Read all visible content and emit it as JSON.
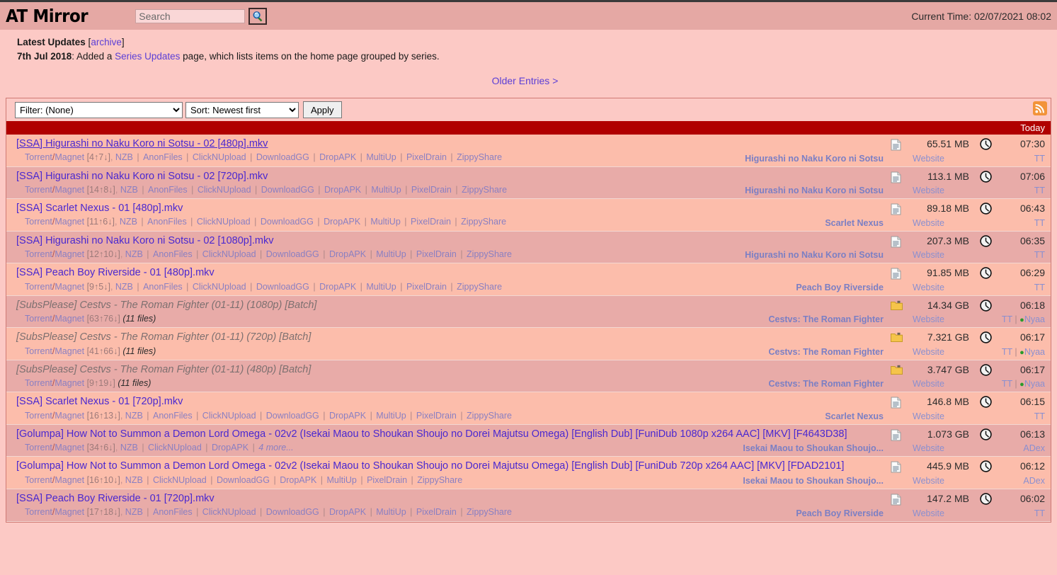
{
  "header": {
    "logo": "AT Mirror",
    "search_placeholder": "Search",
    "search_value": "",
    "search_icon": "magnifier-icon",
    "current_time": "Current Time: 02/07/2021 08:02"
  },
  "updates": {
    "heading": "Latest Updates",
    "archive_bracket_open": "[",
    "archive_label": "archive",
    "archive_bracket_close": "]",
    "date": "7th Jul 2018",
    "text_before": ": Added a ",
    "link_label": "Series Updates",
    "text_after": " page, which lists items on the home page grouped by series."
  },
  "pagination": {
    "older_label": "Older Entries >"
  },
  "toolbar": {
    "filter_selected": "Filter: (None)",
    "sort_selected": "Sort: Newest first",
    "apply_label": "Apply",
    "rss_icon": "rss-icon"
  },
  "day_header": "Today",
  "labels": {
    "torrent": "Torrent",
    "magnet": "Magnet",
    "nzb": "NZB",
    "website": "Website",
    "tt": "TT",
    "nyaa": "Nyaa",
    "adex": "ADex",
    "more": "4 more..."
  },
  "rows": [
    {
      "title": "[SSA] Higurashi no Naku Koro ni Sotsu - 02 [480p].mkv",
      "batch": false,
      "hovered": true,
      "wide": false,
      "peers": "[4↑7↓]",
      "mirrors": [
        "AnonFiles",
        "ClickNUpload",
        "DownloadGG",
        "DropAPK",
        "MultiUp",
        "PixelDrain",
        "ZippyShare"
      ],
      "has_nzb": true,
      "filecount": "",
      "series": "Higurashi no Naku Koro ni Sotsu",
      "size": "65.51 MB",
      "size_icon": "file-icon",
      "time": "07:30",
      "tags": [
        "TT"
      ]
    },
    {
      "title": "[SSA] Higurashi no Naku Koro ni Sotsu - 02 [720p].mkv",
      "batch": false,
      "hovered": false,
      "wide": false,
      "peers": "[14↑8↓]",
      "mirrors": [
        "AnonFiles",
        "ClickNUpload",
        "DownloadGG",
        "DropAPK",
        "MultiUp",
        "PixelDrain",
        "ZippyShare"
      ],
      "has_nzb": true,
      "filecount": "",
      "series": "Higurashi no Naku Koro ni Sotsu",
      "size": "113.1 MB",
      "size_icon": "file-icon",
      "time": "07:06",
      "tags": [
        "TT"
      ]
    },
    {
      "title": "[SSA] Scarlet Nexus - 01 [480p].mkv",
      "batch": false,
      "hovered": false,
      "wide": false,
      "peers": "[11↑6↓]",
      "mirrors": [
        "AnonFiles",
        "ClickNUpload",
        "DownloadGG",
        "DropAPK",
        "MultiUp",
        "PixelDrain",
        "ZippyShare"
      ],
      "has_nzb": true,
      "filecount": "",
      "series": "Scarlet Nexus",
      "size": "89.18 MB",
      "size_icon": "file-icon",
      "time": "06:43",
      "tags": [
        "TT"
      ]
    },
    {
      "title": "[SSA] Higurashi no Naku Koro ni Sotsu - 02 [1080p].mkv",
      "batch": false,
      "hovered": false,
      "wide": false,
      "peers": "[12↑10↓]",
      "mirrors": [
        "AnonFiles",
        "ClickNUpload",
        "DownloadGG",
        "DropAPK",
        "MultiUp",
        "PixelDrain",
        "ZippyShare"
      ],
      "has_nzb": true,
      "filecount": "",
      "series": "Higurashi no Naku Koro ni Sotsu",
      "size": "207.3 MB",
      "size_icon": "file-icon",
      "time": "06:35",
      "tags": [
        "TT"
      ]
    },
    {
      "title": "[SSA] Peach Boy Riverside - 01 [480p].mkv",
      "batch": false,
      "hovered": false,
      "wide": false,
      "peers": "[9↑5↓]",
      "mirrors": [
        "AnonFiles",
        "ClickNUpload",
        "DownloadGG",
        "DropAPK",
        "MultiUp",
        "PixelDrain",
        "ZippyShare"
      ],
      "has_nzb": true,
      "filecount": "",
      "series": "Peach Boy Riverside",
      "size": "91.85 MB",
      "size_icon": "file-icon",
      "time": "06:29",
      "tags": [
        "TT"
      ]
    },
    {
      "title": "[SubsPlease] Cestvs - The Roman Fighter (01-11) (1080p) [Batch]",
      "batch": true,
      "hovered": false,
      "wide": false,
      "peers": "[63↑76↓]",
      "mirrors": [],
      "has_nzb": false,
      "filecount": "(11 files)",
      "series": "Cestvs: The Roman Fighter",
      "size": "14.34 GB",
      "size_icon": "folder-icon",
      "time": "06:18",
      "tags": [
        "TT",
        "Nyaa"
      ]
    },
    {
      "title": "[SubsPlease] Cestvs - The Roman Fighter (01-11) (720p) [Batch]",
      "batch": true,
      "hovered": false,
      "wide": false,
      "peers": "[41↑66↓]",
      "mirrors": [],
      "has_nzb": false,
      "filecount": "(11 files)",
      "series": "Cestvs: The Roman Fighter",
      "size": "7.321 GB",
      "size_icon": "folder-icon",
      "time": "06:17",
      "tags": [
        "TT",
        "Nyaa"
      ]
    },
    {
      "title": "[SubsPlease] Cestvs - The Roman Fighter (01-11) (480p) [Batch]",
      "batch": true,
      "hovered": false,
      "wide": false,
      "peers": "[9↑19↓]",
      "mirrors": [],
      "has_nzb": false,
      "filecount": "(11 files)",
      "series": "Cestvs: The Roman Fighter",
      "size": "3.747 GB",
      "size_icon": "folder-icon",
      "time": "06:17",
      "tags": [
        "TT",
        "Nyaa"
      ]
    },
    {
      "title": "[SSA] Scarlet Nexus - 01 [720p].mkv",
      "batch": false,
      "hovered": false,
      "wide": false,
      "peers": "[16↑13↓]",
      "mirrors": [
        "AnonFiles",
        "ClickNUpload",
        "DownloadGG",
        "DropAPK",
        "MultiUp",
        "PixelDrain",
        "ZippyShare"
      ],
      "has_nzb": true,
      "filecount": "",
      "series": "Scarlet Nexus",
      "size": "146.8 MB",
      "size_icon": "file-icon",
      "time": "06:15",
      "tags": [
        "TT"
      ]
    },
    {
      "title": "[Golumpa] How Not to Summon a Demon Lord Omega - 02v2 (Isekai Maou to Shoukan Shoujo no Dorei Majutsu Omega) [English Dub] [FuniDub 1080p x264 AAC] [MKV] [F4643D38]",
      "batch": false,
      "hovered": false,
      "wide": true,
      "peers": "[34↑6↓]",
      "mirrors": [
        "ClickNUpload",
        "DropAPK"
      ],
      "has_nzb": true,
      "filecount": "",
      "more_label": "4 more...",
      "series": "Isekai Maou to Shoukan Shoujo...",
      "size": "1.073 GB",
      "size_icon": "file-icon",
      "time": "06:13",
      "tags": [
        "ADex"
      ]
    },
    {
      "title": "[Golumpa] How Not to Summon a Demon Lord Omega - 02v2 (Isekai Maou to Shoukan Shoujo no Dorei Majutsu Omega) [English Dub] [FuniDub 720p x264 AAC] [MKV] [FDAD2101]",
      "batch": false,
      "hovered": false,
      "wide": true,
      "peers": "[16↑10↓]",
      "mirrors": [
        "ClickNUpload",
        "DownloadGG",
        "DropAPK",
        "MultiUp",
        "PixelDrain",
        "ZippyShare"
      ],
      "has_nzb": true,
      "filecount": "",
      "series": "Isekai Maou to Shoukan Shoujo...",
      "size": "445.9 MB",
      "size_icon": "file-icon",
      "time": "06:12",
      "tags": [
        "ADex"
      ]
    },
    {
      "title": "[SSA] Peach Boy Riverside - 01 [720p].mkv",
      "batch": false,
      "hovered": false,
      "wide": false,
      "peers": "[17↑18↓]",
      "mirrors": [
        "AnonFiles",
        "ClickNUpload",
        "DownloadGG",
        "DropAPK",
        "MultiUp",
        "PixelDrain",
        "ZippyShare"
      ],
      "has_nzb": true,
      "filecount": "",
      "series": "Peach Boy Riverside",
      "size": "147.2 MB",
      "size_icon": "file-icon",
      "time": "06:02",
      "tags": [
        "TT"
      ]
    }
  ],
  "colors": {
    "header_bg": "#e5a8a4",
    "page_bg": "#fcc9c5",
    "row_odd": "#fcbdab",
    "row_even": "#e8aba8",
    "day_bar": "#b00000",
    "link": "#5b3fd6",
    "title_link": "#4a28d0",
    "series": "#7b7fc4",
    "rss": "#f29339"
  }
}
